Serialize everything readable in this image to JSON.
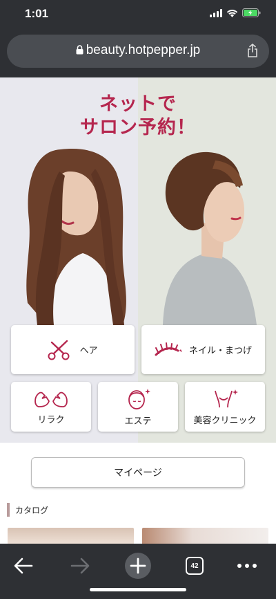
{
  "status_bar": {
    "time": "1:01"
  },
  "browser": {
    "url": "beauty.hotpepper.jp",
    "tab_count": "42"
  },
  "hero": {
    "title_line1": "ネットで",
    "title_line2": "サロン予約！"
  },
  "categories": [
    {
      "label": "ヘア",
      "icon": "scissors-icon"
    },
    {
      "label": "ネイル・まつげ",
      "icon": "eyelash-icon"
    },
    {
      "label": "リラク",
      "icon": "hands-icon"
    },
    {
      "label": "エステ",
      "icon": "face-icon"
    },
    {
      "label": "美容クリニック",
      "icon": "body-icon"
    }
  ],
  "mypage": {
    "label": "マイページ"
  },
  "catalog": {
    "label": "カタログ"
  },
  "colors": {
    "accent": "#b5264e",
    "chrome": "#2e3034"
  }
}
